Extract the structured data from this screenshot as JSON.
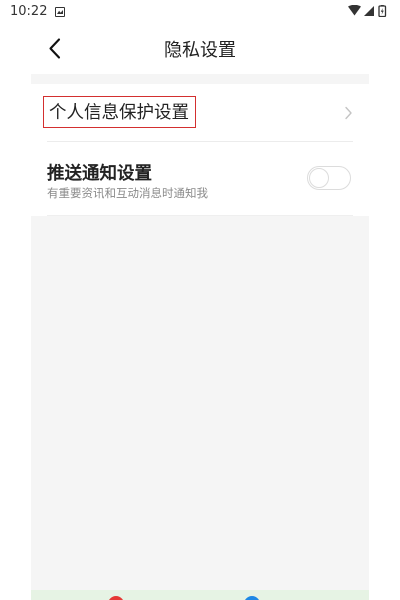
{
  "status_bar": {
    "time": "10:22",
    "notification_icon": "image-notification-icon",
    "icons": [
      "wifi-icon",
      "cellular-signal-icon",
      "battery-charging-icon"
    ]
  },
  "header": {
    "title": "隐私设置",
    "back_icon": "chevron-left-icon"
  },
  "settings": {
    "privacy_item": {
      "label": "个人信息保护设置",
      "icon": "chevron-right-icon",
      "highlight_color": "#d32f2f"
    },
    "push_item": {
      "title": "推送通知设置",
      "subtitle": "有重要资讯和互动消息时通知我",
      "toggle_on": false
    }
  },
  "colors": {
    "background": "#f5f5f5",
    "card": "#ffffff",
    "bottom_strip": "#e6f3e4",
    "red_accent": "#e53935",
    "blue_accent": "#1e88e5"
  }
}
